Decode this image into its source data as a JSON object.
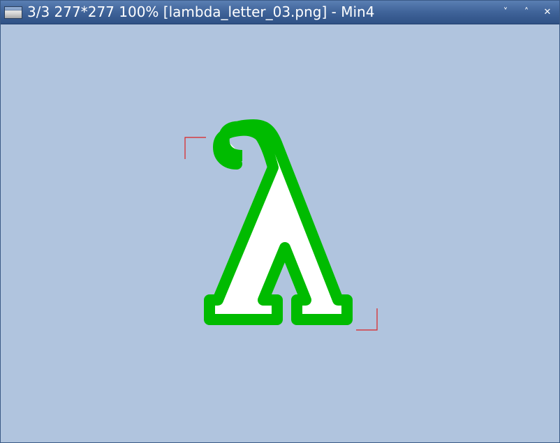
{
  "window": {
    "title": "3/3 277*277 100% [lambda_letter_03.png] - Min4",
    "controls": {
      "minimize": "˅",
      "maximize": "˄",
      "close": "✕"
    }
  },
  "viewer": {
    "background_color": "#b0c4de",
    "image": {
      "icon": "lambda-letter-image",
      "glyph_fill": "#ffffff",
      "glyph_outline": "#00bb00"
    },
    "selection_marker_color": "#dd2222"
  }
}
